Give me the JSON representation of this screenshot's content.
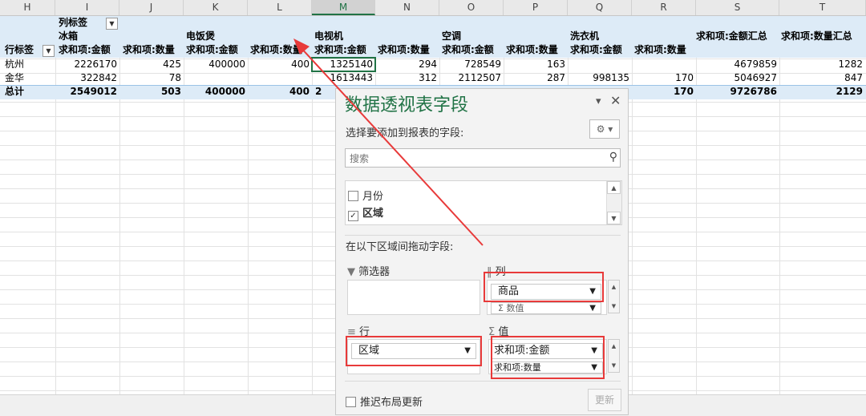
{
  "columns": [
    "H",
    "I",
    "J",
    "K",
    "L",
    "M",
    "N",
    "O",
    "P",
    "Q",
    "R",
    "S",
    "T"
  ],
  "selected_column": "M",
  "pivot": {
    "col_labels": "列标签",
    "row_labels": "行标签",
    "total_label": "总计",
    "groups": [
      "冰箱",
      "电饭煲",
      "电视机",
      "空调",
      "洗衣机"
    ],
    "measure_amount": "求和项:金额",
    "measure_qty": "求和项:数量",
    "total_amount_header": "求和项:金额汇总",
    "total_qty_header": "求和项:数量汇总",
    "rows": [
      {
        "label": "杭州",
        "values": [
          "2226170",
          "425",
          "400000",
          "400",
          "1325140",
          "294",
          "728549",
          "163",
          "",
          "",
          "4679859",
          "1282"
        ]
      },
      {
        "label": "金华",
        "values": [
          "322842",
          "78",
          "",
          "",
          "1613443",
          "312",
          "2112507",
          "287",
          "998135",
          "170",
          "5046927",
          "847"
        ]
      }
    ],
    "totals": [
      "2549012",
      "503",
      "400000",
      "400",
      "2",
      "",
      "",
      "",
      "",
      "170",
      "9726786",
      "2129"
    ]
  },
  "pane": {
    "title": "数据透视表字段",
    "subtitle": "选择要添加到报表的字段:",
    "search_placeholder": "搜索",
    "fields": [
      {
        "label": "月份",
        "checked": false
      },
      {
        "label": "区域",
        "checked": true
      }
    ],
    "drag_hint": "在以下区域间拖动字段:",
    "filters_label": "筛选器",
    "columns_label": "列",
    "rows_label": "行",
    "values_label": "值",
    "column_fields": [
      "商品",
      "Σ 数值"
    ],
    "row_fields": [
      "区域"
    ],
    "value_fields": [
      "求和项:金额",
      "求和项:数量"
    ],
    "defer_label": "推迟布局更新",
    "update_label": "更新"
  },
  "colors": {
    "accent": "#217346",
    "highlight": "#e83a3a",
    "pivot_band": "#ddebf7"
  },
  "icons": {
    "search": "search-icon",
    "gear": "gear-icon",
    "close": "close-icon",
    "filter": "filter-icon",
    "columns": "columns-icon",
    "rows": "rows-icon",
    "sigma": "sigma-icon"
  }
}
